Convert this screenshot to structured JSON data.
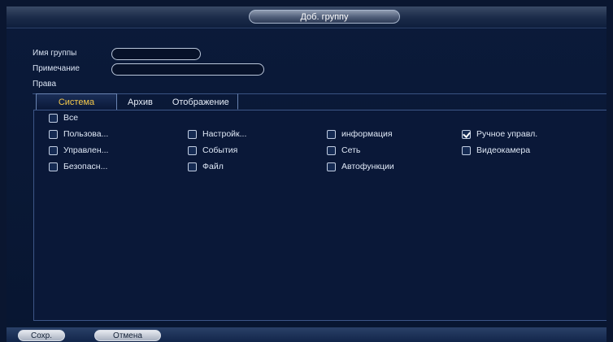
{
  "dialog": {
    "title": "Доб. группу"
  },
  "form": {
    "group_name_label": "Имя группы",
    "group_name_value": "",
    "note_label": "Примечание",
    "note_value": "",
    "rights_label": "Права"
  },
  "tabs": [
    "Система",
    "Архив",
    "Отображение"
  ],
  "permissions": {
    "all": {
      "label": "Все",
      "checked": false
    },
    "items": [
      {
        "label": "Пользова...",
        "checked": false
      },
      {
        "label": "Настройк...",
        "checked": false
      },
      {
        "label": "информация",
        "checked": false
      },
      {
        "label": "Ручное управл.",
        "checked": true
      },
      {
        "label": "Управлен...",
        "checked": false
      },
      {
        "label": "События",
        "checked": false
      },
      {
        "label": "Сеть",
        "checked": false
      },
      {
        "label": "Видеокамера",
        "checked": false
      },
      {
        "label": "Безопасн...",
        "checked": false
      },
      {
        "label": "Файл",
        "checked": false
      },
      {
        "label": "Автофункции",
        "checked": false
      }
    ]
  },
  "footer": {
    "save_label": "Сохр.",
    "cancel_label": "Отмена"
  },
  "colors": {
    "background": "#0a1630",
    "active_tab_text": "#f4c84a",
    "panel_border": "#3d5687"
  }
}
